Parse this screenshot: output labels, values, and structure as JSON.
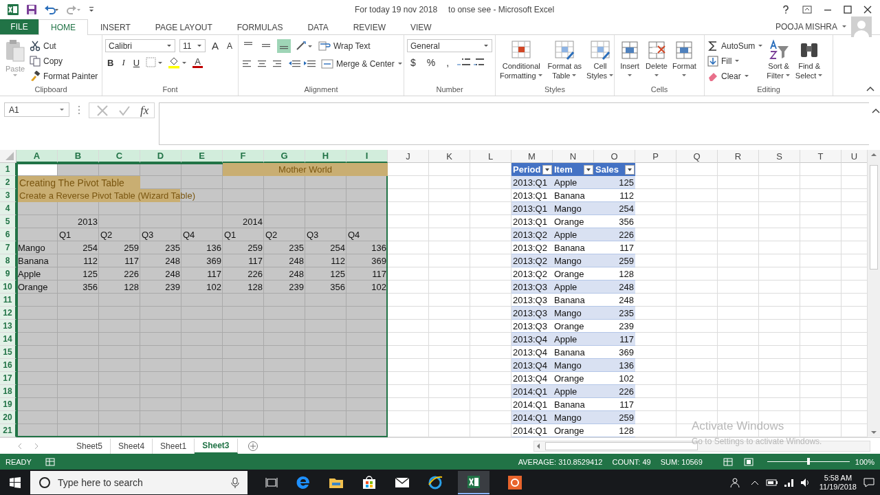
{
  "window": {
    "title_parts": [
      "For today 19 nov 2018",
      "to onse see - Microsoft Excel"
    ],
    "user": "POOJA MISHRA"
  },
  "ribbon_tabs": [
    {
      "label": "FILE",
      "kind": "file",
      "selected": false
    },
    {
      "label": "HOME",
      "kind": "tab",
      "selected": true
    },
    {
      "label": "INSERT",
      "kind": "tab",
      "selected": false
    },
    {
      "label": "PAGE LAYOUT",
      "kind": "tab",
      "selected": false
    },
    {
      "label": "FORMULAS",
      "kind": "tab",
      "selected": false
    },
    {
      "label": "DATA",
      "kind": "tab",
      "selected": false
    },
    {
      "label": "REVIEW",
      "kind": "tab",
      "selected": false
    },
    {
      "label": "VIEW",
      "kind": "tab",
      "selected": false
    }
  ],
  "clipboard": {
    "title": "Clipboard",
    "paste": {
      "label": "Paste",
      "disabled": true
    },
    "items": [
      "Cut",
      "Copy",
      "Format Painter"
    ]
  },
  "font": {
    "title": "Font",
    "name": "Calibri",
    "size": "11",
    "size_buttons": [
      "A",
      "A"
    ],
    "style_buttons": [
      "B",
      "I",
      "U"
    ],
    "color_button": "A"
  },
  "alignment": {
    "title": "Alignment",
    "vertical": [
      {
        "selected": false
      },
      {
        "selected": false
      },
      {
        "selected": true
      }
    ],
    "wrap": "Wrap Text",
    "merge": "Merge & Center"
  },
  "number": {
    "title": "Number",
    "format": "General",
    "symbols": [
      "$",
      "%",
      ","
    ]
  },
  "styles": {
    "title": "Styles",
    "buttons": [
      [
        "Conditional",
        "Formatting"
      ],
      [
        "Format as",
        "Table"
      ],
      [
        "Cell",
        "Styles"
      ]
    ]
  },
  "cells": {
    "title": "Cells",
    "buttons": [
      "Insert",
      "Delete",
      "Format"
    ]
  },
  "editing": {
    "title": "Editing",
    "small": [
      "AutoSum",
      "Fill",
      "Clear"
    ],
    "big": [
      [
        "Sort &",
        "Filter"
      ],
      [
        "Find &",
        "Select"
      ]
    ]
  },
  "formula_bar": {
    "name_box": "A1",
    "fx": "fx"
  },
  "sheet": {
    "columns": [
      {
        "label": "A",
        "selected": true
      },
      {
        "label": "B",
        "selected": true
      },
      {
        "label": "C",
        "selected": true
      },
      {
        "label": "D",
        "selected": true
      },
      {
        "label": "E",
        "selected": true
      },
      {
        "label": "F",
        "selected": true
      },
      {
        "label": "G",
        "selected": true
      },
      {
        "label": "H",
        "selected": true
      },
      {
        "label": "I",
        "selected": true
      },
      {
        "label": "J",
        "selected": false
      },
      {
        "label": "K",
        "selected": false
      },
      {
        "label": "L",
        "selected": false
      },
      {
        "label": "M",
        "selected": false
      },
      {
        "label": "N",
        "selected": false
      },
      {
        "label": "O",
        "selected": false
      },
      {
        "label": "P",
        "selected": false
      },
      {
        "label": "Q",
        "selected": false
      },
      {
        "label": "R",
        "selected": false
      },
      {
        "label": "S",
        "selected": false
      },
      {
        "label": "T",
        "selected": false
      },
      {
        "label": "U",
        "selected": false
      }
    ],
    "rows": [
      {
        "label": "1",
        "selected": true
      },
      {
        "label": "2",
        "selected": true
      },
      {
        "label": "3",
        "selected": true
      },
      {
        "label": "4",
        "selected": true
      },
      {
        "label": "5",
        "selected": true
      },
      {
        "label": "6",
        "selected": true
      },
      {
        "label": "7",
        "selected": true
      },
      {
        "label": "8",
        "selected": true
      },
      {
        "label": "9",
        "selected": true
      },
      {
        "label": "10",
        "selected": true
      },
      {
        "label": "11",
        "selected": true
      },
      {
        "label": "12",
        "selected": true
      },
      {
        "label": "13",
        "selected": true
      },
      {
        "label": "14",
        "selected": true
      },
      {
        "label": "15",
        "selected": true
      },
      {
        "label": "16",
        "selected": true
      },
      {
        "label": "17",
        "selected": true
      },
      {
        "label": "18",
        "selected": true
      },
      {
        "label": "19",
        "selected": true
      },
      {
        "label": "20",
        "selected": true
      },
      {
        "label": "21",
        "selected": true
      }
    ],
    "banner": "Mother World",
    "headings": [
      "Creating The Pivot Table",
      "Create a Reverse Pivot Table (Wizard Table)"
    ],
    "years": [
      "2013",
      "2014"
    ],
    "quarters": [
      "Q1",
      "Q2",
      "Q3",
      "Q4",
      "Q1",
      "Q2",
      "Q3",
      "Q4"
    ],
    "data_rows": [
      {
        "item": "Mango",
        "values": [
          "254",
          "259",
          "235",
          "136",
          "259",
          "235",
          "254",
          "136"
        ]
      },
      {
        "item": "Banana",
        "values": [
          "112",
          "117",
          "248",
          "369",
          "117",
          "248",
          "112",
          "369"
        ]
      },
      {
        "item": "Apple",
        "values": [
          "125",
          "226",
          "248",
          "117",
          "226",
          "248",
          "125",
          "117"
        ]
      },
      {
        "item": "Orange",
        "values": [
          "356",
          "128",
          "239",
          "102",
          "128",
          "239",
          "356",
          "102"
        ]
      }
    ],
    "table": {
      "columns": [
        "Period",
        "Item",
        "Sales"
      ],
      "rows": [
        [
          "2013:Q1",
          "Apple",
          "125"
        ],
        [
          "2013:Q1",
          "Banana",
          "112"
        ],
        [
          "2013:Q1",
          "Mango",
          "254"
        ],
        [
          "2013:Q1",
          "Orange",
          "356"
        ],
        [
          "2013:Q2",
          "Apple",
          "226"
        ],
        [
          "2013:Q2",
          "Banana",
          "117"
        ],
        [
          "2013:Q2",
          "Mango",
          "259"
        ],
        [
          "2013:Q2",
          "Orange",
          "128"
        ],
        [
          "2013:Q3",
          "Apple",
          "248"
        ],
        [
          "2013:Q3",
          "Banana",
          "248"
        ],
        [
          "2013:Q3",
          "Mango",
          "235"
        ],
        [
          "2013:Q3",
          "Orange",
          "239"
        ],
        [
          "2013:Q4",
          "Apple",
          "117"
        ],
        [
          "2013:Q4",
          "Banana",
          "369"
        ],
        [
          "2013:Q4",
          "Mango",
          "136"
        ],
        [
          "2013:Q4",
          "Orange",
          "102"
        ],
        [
          "2014:Q1",
          "Apple",
          "226"
        ],
        [
          "2014:Q1",
          "Banana",
          "117"
        ],
        [
          "2014:Q1",
          "Mango",
          "259"
        ],
        [
          "2014:Q1",
          "Orange",
          "128"
        ]
      ]
    }
  },
  "sheet_tabs": [
    {
      "label": "Sheet5",
      "selected": false
    },
    {
      "label": "Sheet4",
      "selected": false
    },
    {
      "label": "Sheet1",
      "selected": false
    },
    {
      "label": "Sheet3",
      "selected": true
    }
  ],
  "status_bar": {
    "mode": "READY",
    "average": "AVERAGE: 310.8529412",
    "count": "COUNT: 49",
    "sum": "SUM: 10569",
    "zoom": "100%"
  },
  "activation": {
    "title": "Activate Windows",
    "message": "Go to Settings to activate Windows."
  },
  "taskbar": {
    "search_placeholder": "Type here to search",
    "time": "5:58 AM",
    "date": "11/19/2018"
  }
}
